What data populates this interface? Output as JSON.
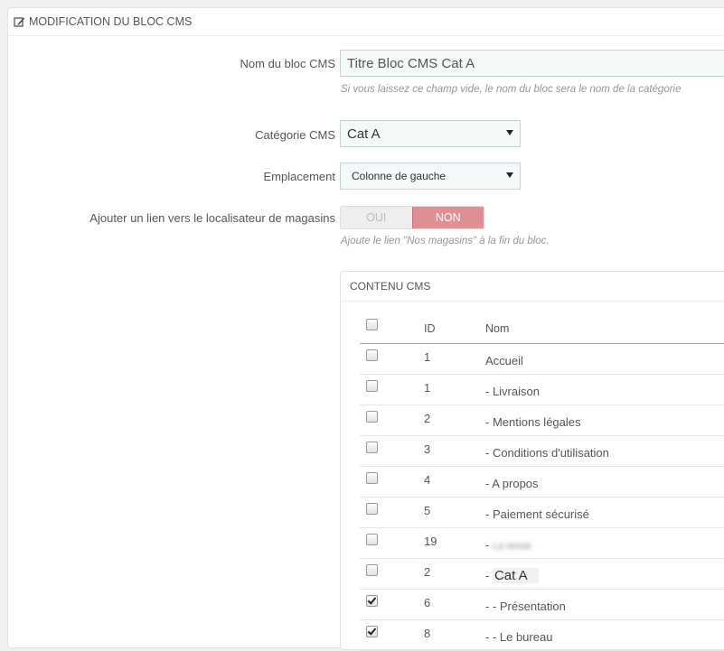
{
  "panel": {
    "title": "MODIFICATION DU BLOC CMS",
    "icon": "edit-icon"
  },
  "form": {
    "name_label": "Nom du bloc CMS",
    "name_value": "Titre Bloc CMS Cat A",
    "name_help": "Si vous laissez ce champ vide, le nom du bloc sera le nom de la catégorie",
    "category_label": "Catégorie CMS",
    "category_value": "Cat A",
    "location_label": "Emplacement",
    "location_value": "Colonne de gauche",
    "store_link_label": "Ajouter un lien vers le localisateur de magasins",
    "store_link_yes": "OUI",
    "store_link_no": "NON",
    "store_link_help": "Ajoute le lien \"Nos magasins\" à la fin du bloc."
  },
  "content": {
    "title": "CONTENU CMS",
    "headers": {
      "id": "ID",
      "name": "Nom"
    },
    "rows": [
      {
        "id": "1",
        "name": "Accueil",
        "checked": false
      },
      {
        "id": "1",
        "name": "- Livraison",
        "checked": false
      },
      {
        "id": "2",
        "name": "- Mentions légales",
        "checked": false
      },
      {
        "id": "3",
        "name": "- Conditions d'utilisation",
        "checked": false
      },
      {
        "id": "4",
        "name": "- A propos",
        "checked": false
      },
      {
        "id": "5",
        "name": "- Paiement sécurisé",
        "checked": false
      },
      {
        "id": "19",
        "name": "- ",
        "blurred": "La revue",
        "checked": false
      },
      {
        "id": "2",
        "name": "- ",
        "highlight": "Cat A",
        "checked": false
      },
      {
        "id": "6",
        "name": "- - Présentation",
        "checked": true
      },
      {
        "id": "8",
        "name": "- - Le bureau",
        "checked": true
      }
    ]
  },
  "colors": {
    "accent_off": "#e08f95",
    "input_bg": "#f5f8f9"
  }
}
